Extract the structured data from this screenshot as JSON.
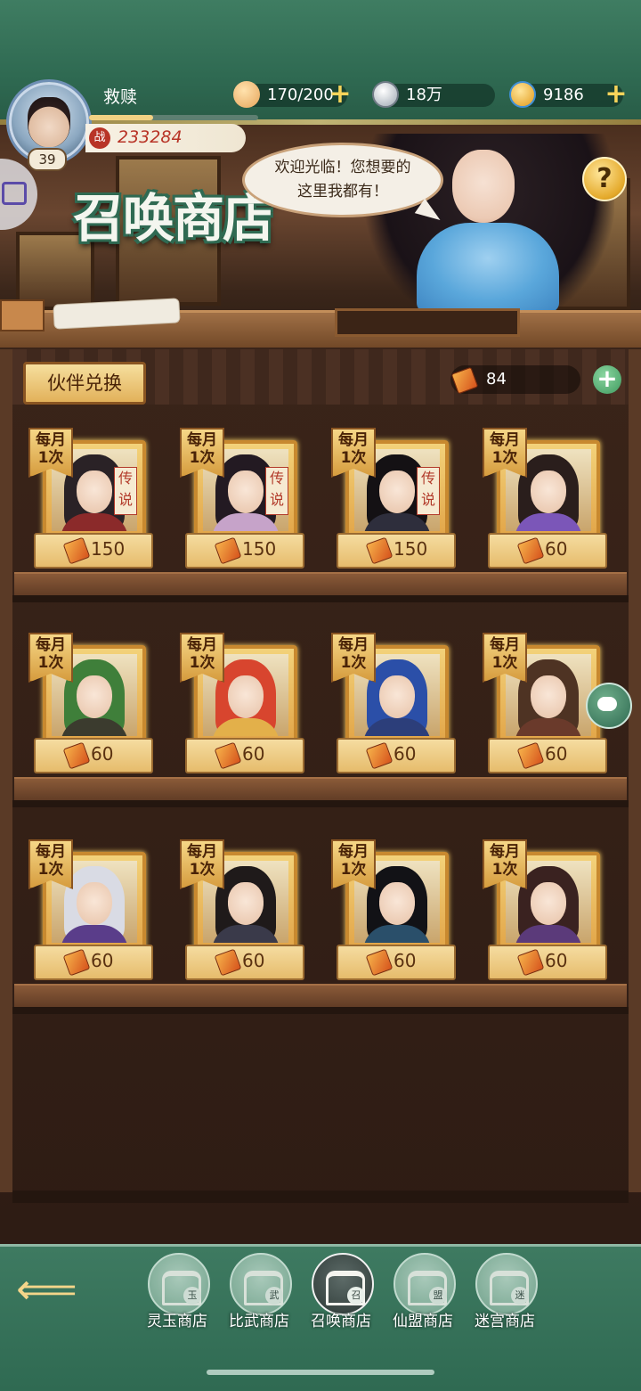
{
  "player": {
    "name": "救赎",
    "level": "39",
    "power_label": "战",
    "power": "233284",
    "xp_fraction": 0.38
  },
  "resources": [
    {
      "name": "stamina",
      "icon": "bun-icon",
      "value": "170/200",
      "color": "#f2c27a"
    },
    {
      "name": "coins",
      "icon": "coin-icon",
      "value": "18万",
      "color": "#cfd6dd"
    },
    {
      "name": "jade",
      "icon": "spiral-jade-icon",
      "value": "9186",
      "color": "#f7c04a"
    }
  ],
  "scene": {
    "title": "召唤商店",
    "speech": "欢迎光临！您想要的\n这里我都有！",
    "help": "?"
  },
  "shop": {
    "tab_label": "伙伴兑换",
    "currency_amount": "84",
    "monthly_badge": "每月\n1次",
    "legend_tag": "传\n说",
    "items": [
      {
        "price": "150",
        "legend": true,
        "hair": "#2a2226",
        "robe": "#8b2a2a"
      },
      {
        "price": "150",
        "legend": true,
        "hair": "#231a22",
        "robe": "#c6a3c9"
      },
      {
        "price": "150",
        "legend": true,
        "hair": "#141114",
        "robe": "#2e2e3c"
      },
      {
        "price": "60",
        "legend": false,
        "hair": "#2a1e1c",
        "robe": "#7b56b8"
      },
      {
        "price": "60",
        "legend": false,
        "hair": "#3f7f3a",
        "robe": "#3b3b2e"
      },
      {
        "price": "60",
        "legend": false,
        "hair": "#d8452e",
        "robe": "#e3b04a"
      },
      {
        "price": "60",
        "legend": false,
        "hair": "#2b4fa8",
        "robe": "#2c3e7a"
      },
      {
        "price": "60",
        "legend": false,
        "hair": "#4e3323",
        "robe": "#6a3a2b"
      },
      {
        "price": "60",
        "legend": false,
        "hair": "#d9dbe4",
        "robe": "#5a3d8a"
      },
      {
        "price": "60",
        "legend": false,
        "hair": "#1f1a1a",
        "robe": "#3a3a4a"
      },
      {
        "price": "60",
        "legend": false,
        "hair": "#121216",
        "robe": "#2a4f6a"
      },
      {
        "price": "60",
        "legend": false,
        "hair": "#3a2220",
        "robe": "#5b3a7a"
      }
    ]
  },
  "nav": {
    "back_icon": "arrow-back-icon",
    "tabs": [
      {
        "label": "灵玉商店",
        "seal": "玉",
        "active": false
      },
      {
        "label": "比武商店",
        "seal": "武",
        "active": false
      },
      {
        "label": "召唤商店",
        "seal": "召",
        "active": true
      },
      {
        "label": "仙盟商店",
        "seal": "盟",
        "active": false
      },
      {
        "label": "迷宫商店",
        "seal": "迷",
        "active": false
      }
    ]
  }
}
